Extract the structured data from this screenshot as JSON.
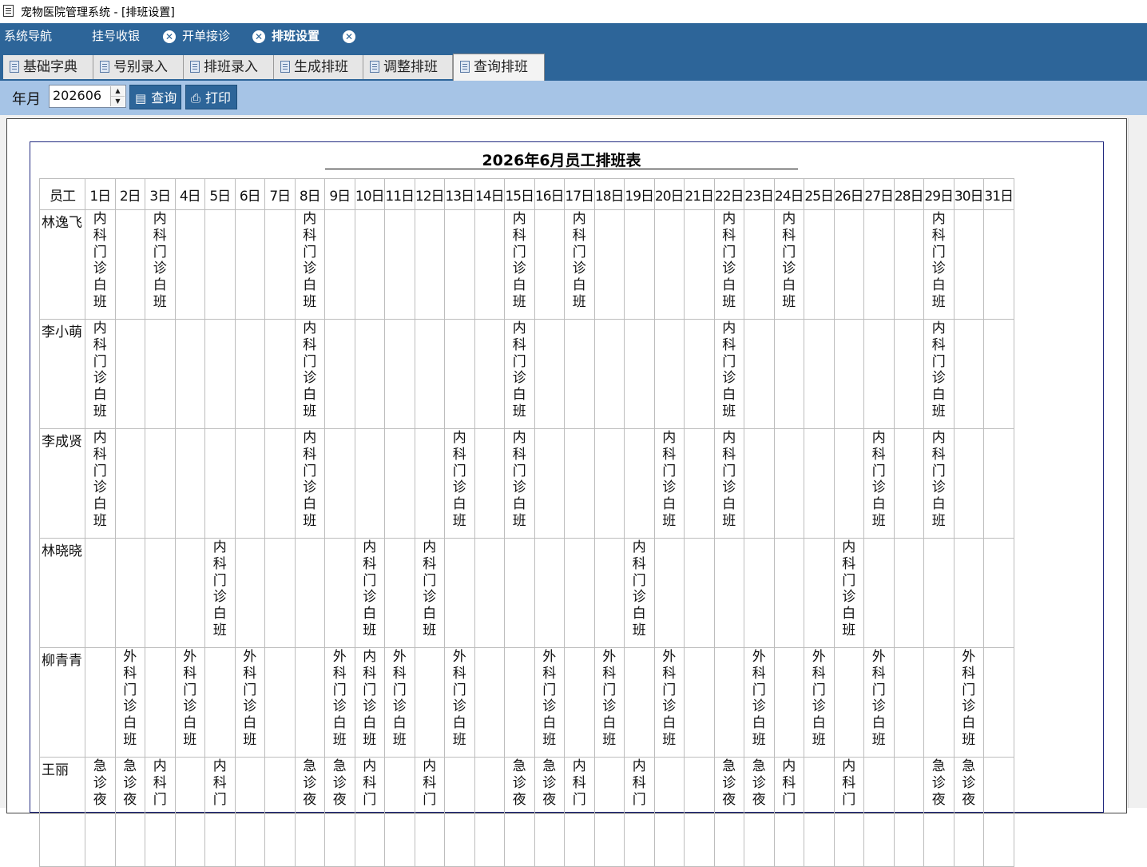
{
  "window": {
    "title": "宠物医院管理系统 - [排班设置]"
  },
  "menu": {
    "items": [
      {
        "label": "系统导航"
      },
      {
        "label": "挂号收银"
      },
      {
        "label": "开单接诊"
      },
      {
        "label": "排班设置"
      }
    ]
  },
  "tabs": [
    {
      "label": "基础字典"
    },
    {
      "label": "号别录入"
    },
    {
      "label": "排班录入"
    },
    {
      "label": "生成排班"
    },
    {
      "label": "调整排班"
    },
    {
      "label": "查询排班"
    }
  ],
  "active_tab": "查询排班",
  "toolbar": {
    "year_month_label": "年月",
    "year_month_value": "202606",
    "query_label": "查询",
    "print_label": "打印"
  },
  "report": {
    "title": "2026年6月员工排班表",
    "employee_header": "员工",
    "days": [
      "1日",
      "2日",
      "3日",
      "4日",
      "5日",
      "6日",
      "7日",
      "8日",
      "9日",
      "10日",
      "11日",
      "12日",
      "13日",
      "14日",
      "15日",
      "16日",
      "17日",
      "18日",
      "19日",
      "20日",
      "21日",
      "22日",
      "23日",
      "24日",
      "25日",
      "26日",
      "27日",
      "28日",
      "29日",
      "30日",
      "31日"
    ],
    "rows": [
      {
        "employee": "林逸飞",
        "shifts": [
          "内科门诊白班",
          "",
          "内科门诊白班",
          "",
          "",
          "",
          "",
          "内科门诊白班",
          "",
          "",
          "",
          "",
          "",
          "",
          "内科门诊白班",
          "",
          "内科门诊白班",
          "",
          "",
          "",
          "",
          "内科门诊白班",
          "",
          "内科门诊白班",
          "",
          "",
          "",
          "",
          "内科门诊白班",
          "",
          ""
        ]
      },
      {
        "employee": "李小萌",
        "shifts": [
          "内科门诊白班",
          "",
          "",
          "",
          "",
          "",
          "",
          "内科门诊白班",
          "",
          "",
          "",
          "",
          "",
          "",
          "内科门诊白班",
          "",
          "",
          "",
          "",
          "",
          "",
          "内科门诊白班",
          "",
          "",
          "",
          "",
          "",
          "",
          "内科门诊白班",
          "",
          ""
        ]
      },
      {
        "employee": "李成贤",
        "shifts": [
          "内科门诊白班",
          "",
          "",
          "",
          "",
          "",
          "",
          "内科门诊白班",
          "",
          "",
          "",
          "",
          "内科门诊白班",
          "",
          "内科门诊白班",
          "",
          "",
          "",
          "",
          "内科门诊白班",
          "",
          "内科门诊白班",
          "",
          "",
          "",
          "",
          "内科门诊白班",
          "",
          "内科门诊白班",
          "",
          ""
        ]
      },
      {
        "employee": "林晓晓",
        "shifts": [
          "",
          "",
          "",
          "",
          "内科门诊白班",
          "",
          "",
          "",
          "",
          "内科门诊白班",
          "",
          "内科门诊白班",
          "",
          "",
          "",
          "",
          "",
          "",
          "内科门诊白班",
          "",
          "",
          "",
          "",
          "",
          "",
          "内科门诊白班",
          "",
          "",
          "",
          "",
          ""
        ]
      },
      {
        "employee": "柳青青",
        "shifts": [
          "",
          "外科门诊白班",
          "",
          "外科门诊白班",
          "",
          "外科门诊白班",
          "",
          "",
          "外科门诊白班",
          "内科门诊白班",
          "外科门诊白班",
          "",
          "外科门诊白班",
          "",
          "",
          "外科门诊白班",
          "",
          "外科门诊白班",
          "",
          "外科门诊白班",
          "",
          "",
          "外科门诊白班",
          "",
          "外科门诊白班",
          "",
          "外科门诊白班",
          "",
          "",
          "外科门诊白班",
          ""
        ]
      },
      {
        "employee": "王丽",
        "shifts": [
          "急诊夜",
          "急诊夜",
          "内科门",
          "",
          "内科门",
          "",
          "",
          "急诊夜",
          "急诊夜",
          "内科门",
          "",
          "内科门",
          "",
          "",
          "急诊夜",
          "急诊夜",
          "内科门",
          "",
          "内科门",
          "",
          "",
          "急诊夜",
          "急诊夜",
          "内科门",
          "",
          "内科门",
          "",
          "",
          "急诊夜",
          "急诊夜",
          ""
        ]
      }
    ]
  }
}
